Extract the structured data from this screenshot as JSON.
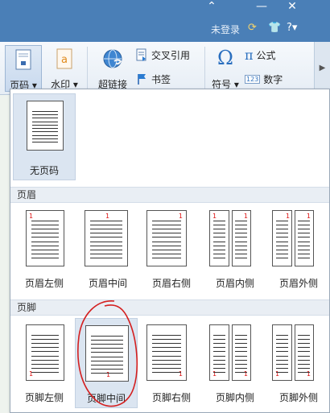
{
  "titlebar": {
    "login_text": "未登录",
    "controls": [
      "⌃",
      "—",
      "✕"
    ]
  },
  "ribbon": {
    "page_number": "页码",
    "watermark": "水印",
    "hyperlink": "超链接",
    "cross_reference": "交叉引用",
    "bookmark": "书签",
    "symbol": "符号",
    "formula": "公式",
    "number": "数字",
    "number_icon_text": "123"
  },
  "panel": {
    "no_page_number": "无页码",
    "header_section": "页眉",
    "footer_section": "页脚",
    "header_options": [
      "页眉左侧",
      "页眉中间",
      "页眉右侧",
      "页眉内侧",
      "页眉外侧"
    ],
    "footer_options": [
      "页脚左侧",
      "页脚中间",
      "页脚右侧",
      "页脚内侧",
      "页脚外侧"
    ],
    "page_num_marker": "1"
  },
  "colors": {
    "titlebar": "#4a7fb7",
    "selected_tile": "#dbe5f1",
    "page_number_red": "#dd1111",
    "annotation_red": "#d42020"
  }
}
